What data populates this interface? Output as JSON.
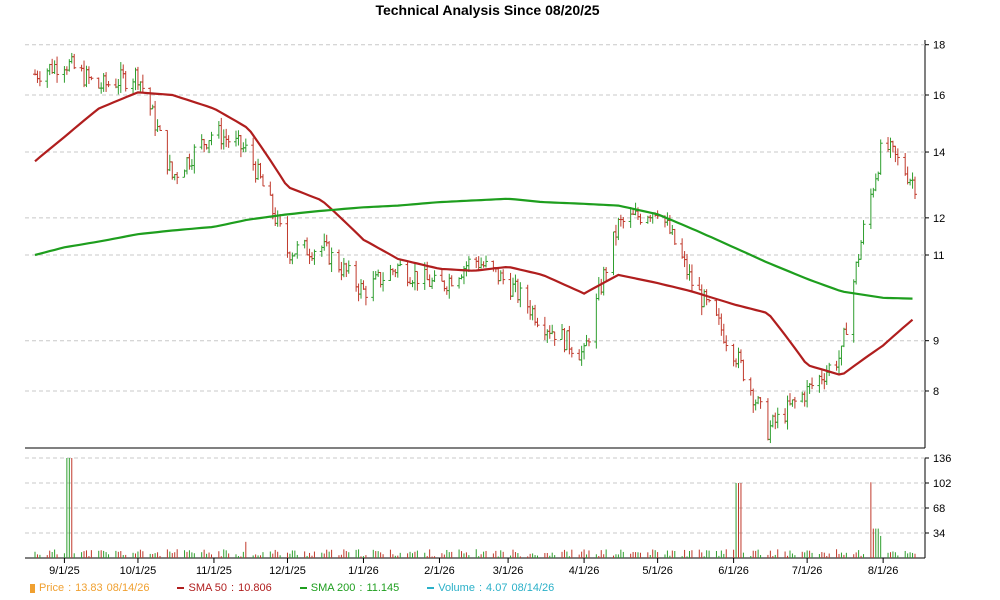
{
  "chart_data": {
    "type": "line",
    "title": "Technical Analysis Since 08/20/25",
    "x_tick_labels": [
      "9/1/25",
      "10/1/25",
      "11/1/25",
      "12/1/25",
      "1/1/26",
      "2/1/26",
      "3/1/26",
      "4/1/26",
      "5/1/26",
      "6/1/26",
      "7/1/26",
      "8/1/26"
    ],
    "price_axis": {
      "ticks": [
        "8",
        "9",
        "11",
        "12",
        "14",
        "16",
        "18"
      ],
      "range": [
        7,
        18.2
      ],
      "scale": "log"
    },
    "volume_axis": {
      "ticks": [
        "34",
        "68",
        "102",
        "136"
      ],
      "range": [
        0,
        136
      ]
    },
    "grid": true,
    "legend_position": "bottom",
    "series": [
      {
        "name": "Price",
        "type": "ohlc",
        "color": "#2e9e2e",
        "down_color": "#c0392b",
        "legend_value": "13.83",
        "legend_date": "08/14/26",
        "x": [
          "8/20/25",
          "9/1/25",
          "9/15/25",
          "10/1/25",
          "10/15/25",
          "11/1/25",
          "11/15/25",
          "12/1/25",
          "12/15/25",
          "1/1/26",
          "1/15/26",
          "2/1/26",
          "2/15/26",
          "3/1/26",
          "3/15/26",
          "4/1/26",
          "4/15/26",
          "5/1/26",
          "5/15/26",
          "6/1/26",
          "6/15/26",
          "7/1/26",
          "7/15/26",
          "8/1/26",
          "8/14/26"
        ],
        "values": [
          16.8,
          17.3,
          16.3,
          16.8,
          13.2,
          14.7,
          14.0,
          11.1,
          11.2,
          10.1,
          10.7,
          10.2,
          10.9,
          10.3,
          9.4,
          8.7,
          11.8,
          12.3,
          10.3,
          8.8,
          7.3,
          8.0,
          8.7,
          14.3,
          13.0
        ]
      },
      {
        "name": "SMA 50",
        "type": "line",
        "color": "#b01e1e",
        "legend_value": "10.806",
        "x": [
          "8/20/25",
          "9/1/25",
          "9/15/25",
          "10/1/25",
          "10/15/25",
          "11/1/25",
          "11/15/25",
          "12/1/25",
          "12/15/25",
          "1/1/26",
          "1/15/26",
          "2/1/26",
          "2/15/26",
          "3/1/26",
          "3/15/26",
          "4/1/26",
          "4/15/26",
          "5/1/26",
          "5/15/26",
          "6/1/26",
          "6/15/26",
          "7/1/26",
          "7/15/26",
          "8/1/26",
          "8/14/26"
        ],
        "values": [
          13.7,
          14.5,
          15.5,
          16.1,
          16.0,
          15.5,
          14.8,
          12.9,
          12.5,
          11.4,
          10.9,
          10.65,
          10.6,
          10.7,
          10.5,
          10.05,
          10.5,
          10.3,
          10.1,
          9.8,
          9.6,
          8.5,
          8.3,
          8.9,
          9.5
        ]
      },
      {
        "name": "SMA 200",
        "type": "line",
        "color": "#1e9e1e",
        "legend_value": "11.145",
        "x": [
          "8/20/25",
          "9/1/25",
          "9/15/25",
          "10/1/25",
          "10/15/25",
          "11/1/25",
          "11/15/25",
          "12/1/25",
          "12/15/25",
          "1/1/26",
          "1/15/26",
          "2/1/26",
          "2/15/26",
          "3/1/26",
          "3/15/26",
          "4/1/26",
          "4/15/26",
          "5/1/26",
          "5/15/26",
          "6/1/26",
          "6/15/26",
          "7/1/26",
          "7/15/26",
          "8/1/26",
          "8/14/26"
        ],
        "values": [
          11.0,
          11.2,
          11.35,
          11.55,
          11.65,
          11.75,
          11.95,
          12.1,
          12.2,
          12.3,
          12.35,
          12.45,
          12.5,
          12.55,
          12.45,
          12.4,
          12.35,
          12.1,
          11.7,
          11.2,
          10.8,
          10.4,
          10.1,
          9.95,
          9.93
        ]
      },
      {
        "name": "Volume",
        "type": "bar",
        "color": "#2ab0c8",
        "legend_value": "4.07",
        "legend_date": "08/14/26",
        "x": [
          "8/25/25",
          "9/3/25",
          "9/15/25",
          "10/1/25",
          "10/15/25",
          "11/1/25",
          "11/15/25",
          "12/1/25",
          "12/15/25",
          "1/1/26",
          "1/15/26",
          "2/1/26",
          "2/15/26",
          "3/1/26",
          "3/15/26",
          "4/1/26",
          "4/15/26",
          "5/1/26",
          "5/15/26",
          "6/1/26",
          "6/3/26",
          "6/15/26",
          "7/1/26",
          "7/15/26",
          "7/28/26",
          "7/29/26",
          "8/1/26",
          "8/14/26"
        ],
        "values": [
          14,
          136,
          12,
          10,
          8,
          10,
          22,
          10,
          8,
          14,
          8,
          10,
          12,
          16,
          14,
          10,
          16,
          14,
          12,
          16,
          102,
          16,
          12,
          14,
          103,
          40,
          30,
          8
        ]
      }
    ]
  }
}
